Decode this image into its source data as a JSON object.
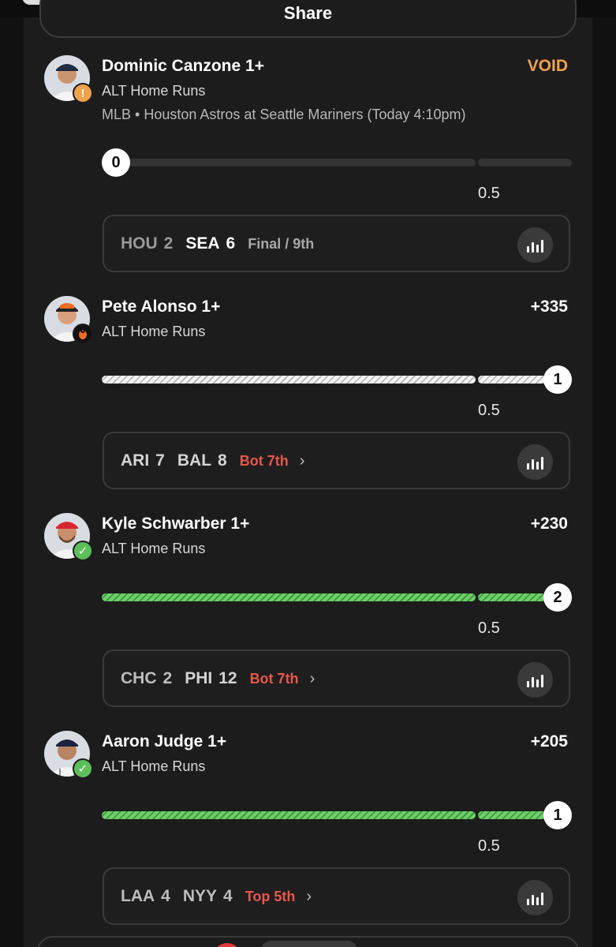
{
  "share": {
    "label": "Share"
  },
  "legs": [
    {
      "player": "Dominic Canzone 1+",
      "odds": "VOID",
      "market": "ALT Home Runs",
      "game_info": "MLB • Houston Astros at Seattle Mariners (Today 4:10pm)",
      "badge": "!",
      "count": "0",
      "line": "0.5",
      "score": {
        "away_team": "HOU",
        "away_score": "2",
        "home_team": "SEA",
        "home_score": "6",
        "status": "Final / 9th"
      }
    },
    {
      "player": "Pete Alonso 1+",
      "odds": "+335",
      "market": "ALT Home Runs",
      "count": "1",
      "line": "0.5",
      "score": {
        "away_team": "ARI",
        "away_score": "7",
        "home_team": "BAL",
        "home_score": "8",
        "status": "Bot 7th"
      }
    },
    {
      "player": "Kyle Schwarber 1+",
      "odds": "+230",
      "market": "ALT Home Runs",
      "badge": "✓",
      "count": "2",
      "line": "0.5",
      "score": {
        "away_team": "CHC",
        "away_score": "2",
        "home_team": "PHI",
        "home_score": "12",
        "status": "Bot 7th"
      }
    },
    {
      "player": "Aaron Judge 1+",
      "odds": "+205",
      "market": "ALT Home Runs",
      "badge": "✓",
      "count": "1",
      "line": "0.5",
      "score": {
        "away_team": "LAA",
        "away_score": "4",
        "home_team": "NYY",
        "home_score": "4",
        "status": "Top 5th"
      }
    }
  ],
  "colors": {
    "void": "#f0a24a",
    "live": "#e8574a",
    "win_green": "#5cbf5a"
  },
  "icons": {
    "chevron": "chevron-right-icon",
    "stats": "bar-chart-icon"
  }
}
